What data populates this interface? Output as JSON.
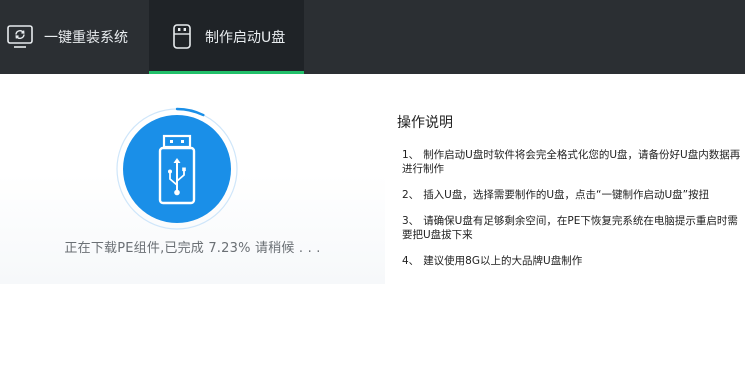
{
  "tabs": [
    {
      "label": "一键重装系统",
      "icon": "monitor-refresh-icon",
      "active": false
    },
    {
      "label": "制作启动U盘",
      "icon": "usb-drive-icon",
      "active": true
    }
  ],
  "colors": {
    "header_bg": "#2b2f33",
    "active_tab_bg": "#1f2327",
    "active_tab_underline": "#22c06a",
    "accent_blue": "#1a8fe8"
  },
  "progress": {
    "text": "正在下载PE组件,已完成 7.23% 请稍候 . . .",
    "percent": 7.23
  },
  "instructions": {
    "title": "操作说明",
    "items": [
      {
        "num": "1、",
        "text": "制作启动U盘时软件将会完全格式化您的U盘，请备份好U盘内数据再进行制作"
      },
      {
        "num": "2、",
        "text": "插入U盘，选择需要制作的U盘，点击“一键制作启动U盘”按扭"
      },
      {
        "num": "3、",
        "text": "请确保U盘有足够剩余空间，在PE下恢复完系统在电脑提示重启时需要把U盘拔下来"
      },
      {
        "num": "4、",
        "text": "建议使用8G以上的大品牌U盘制作"
      }
    ]
  }
}
